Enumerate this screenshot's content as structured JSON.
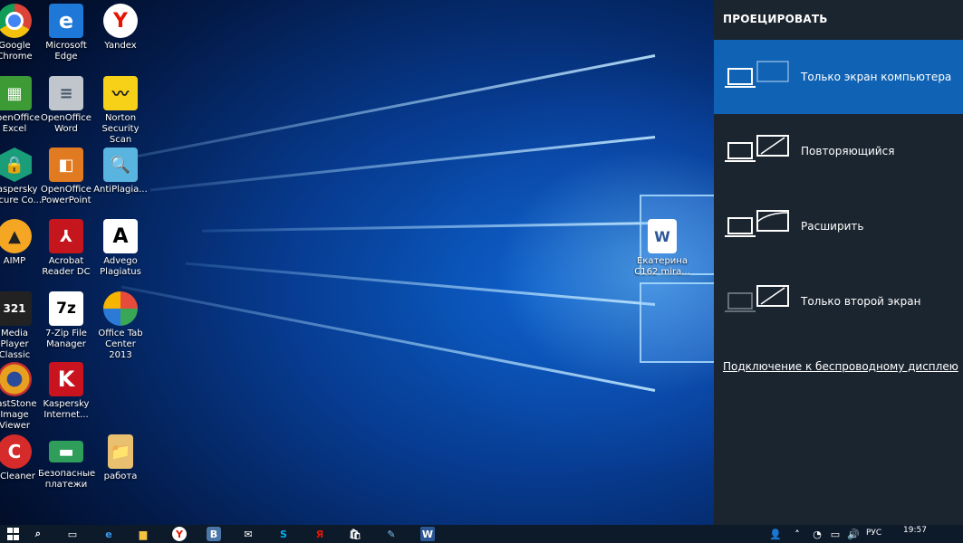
{
  "desktop": {
    "icons": [
      {
        "name": "google-chrome",
        "label": "Google\nChrome",
        "icon": "chrome-icon"
      },
      {
        "name": "microsoft-edge",
        "label": "Microsoft\nEdge",
        "icon": "edge-icon"
      },
      {
        "name": "yandex",
        "label": "Yandex",
        "icon": "yandex-icon"
      },
      {
        "name": "openoffice-excel",
        "label": "OpenOffice\nExcel",
        "icon": "spreadsheet-icon"
      },
      {
        "name": "openoffice-word",
        "label": "OpenOffice\nWord",
        "icon": "document-icon"
      },
      {
        "name": "norton-security-scan",
        "label": "Norton\nSecurity Scan",
        "icon": "norton-icon"
      },
      {
        "name": "kaspersky-secure",
        "label": "Kaspersky\nSecure Co...",
        "icon": "kaspersky-shield-icon"
      },
      {
        "name": "openoffice-powerpoint",
        "label": "OpenOffice\nPowerPoint",
        "icon": "presentation-icon"
      },
      {
        "name": "antiplagiat",
        "label": "AntiPlagia...",
        "icon": "magnifier-icon"
      },
      {
        "name": "aimp",
        "label": "AIMP",
        "icon": "aimp-icon"
      },
      {
        "name": "acrobat-reader",
        "label": "Acrobat\nReader DC",
        "icon": "acrobat-icon"
      },
      {
        "name": "advego-plagiatus",
        "label": "Advego\nPlagiatus",
        "icon": "advego-icon"
      },
      {
        "name": "media-player-classic",
        "label": "Media Player\nClassic",
        "icon": "media-player-icon"
      },
      {
        "name": "7zip-file-manager",
        "label": "7-Zip File\nManager",
        "icon": "7zip-icon"
      },
      {
        "name": "office-tab-center",
        "label": "Office Tab\nCenter 2013",
        "icon": "office-tab-icon"
      },
      {
        "name": "faststone-image-viewer",
        "label": "FastStone\nImage Viewer",
        "icon": "faststone-icon"
      },
      {
        "name": "kaspersky-internet",
        "label": "Kaspersky\nInternet...",
        "icon": "kaspersky-k-icon"
      },
      {
        "name": "ccleaner",
        "label": "CCleaner",
        "icon": "ccleaner-icon"
      },
      {
        "name": "bezopasnye-platezhi",
        "label": "Безопасные\nплатежи",
        "icon": "card-icon"
      },
      {
        "name": "rabota-folder",
        "label": "работа",
        "icon": "folder-icon"
      },
      {
        "name": "word-document",
        "label": "Екатерина\nС162 mira...",
        "icon": "word-document-icon"
      }
    ]
  },
  "project": {
    "title": "ПРОЕЦИРОВАТЬ",
    "options": [
      {
        "label": "Только экран компьютера",
        "selected": true
      },
      {
        "label": "Повторяющийся",
        "selected": false
      },
      {
        "label": "Расширить",
        "selected": false
      },
      {
        "label": "Только второй экран",
        "selected": false
      }
    ],
    "wireless_link": "Подключение к беспроводному дисплею"
  },
  "taskbar": {
    "lang": "РУС",
    "time": "19:57",
    "date": "",
    "apps": [
      "windows-icon",
      "search-icon",
      "task-view-icon",
      "edge-icon",
      "file-explorer-icon",
      "yandex-icon",
      "vk-icon",
      "mail-icon",
      "skype-icon",
      "yandex-browser-icon",
      "store-icon",
      "notepad-icon",
      "word-icon"
    ],
    "tray": [
      "people-icon",
      "chevron-up-icon",
      "network-icon",
      "battery-icon",
      "volume-icon"
    ]
  }
}
